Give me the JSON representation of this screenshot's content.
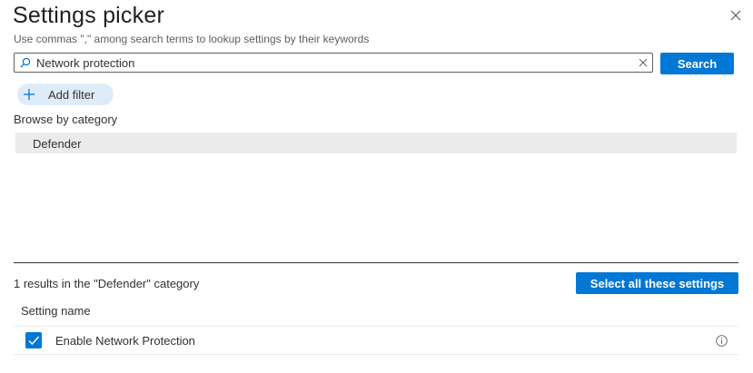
{
  "header": {
    "title": "Settings picker",
    "subtitle": "Use commas \",\" among search terms to lookup settings by their keywords",
    "close_icon": "close-icon"
  },
  "search": {
    "value": "Network protection",
    "placeholder": "",
    "button_label": "Search",
    "icon": "search-icon",
    "clear_icon": "clear-icon"
  },
  "filter": {
    "label": "Add filter",
    "icon": "plus-icon"
  },
  "browse": {
    "label": "Browse by category",
    "categories": [
      {
        "label": "Defender",
        "selected": true
      }
    ]
  },
  "results": {
    "summary": "1 results in the \"Defender\" category",
    "select_all_label": "Select all these settings",
    "column_header": "Setting name",
    "rows": [
      {
        "label": "Enable Network Protection",
        "checked": true,
        "info_icon": "info-icon"
      }
    ]
  },
  "colors": {
    "accent": "#0078d4",
    "filter_pill": "#deecf9",
    "selected_category": "#edebe9"
  }
}
